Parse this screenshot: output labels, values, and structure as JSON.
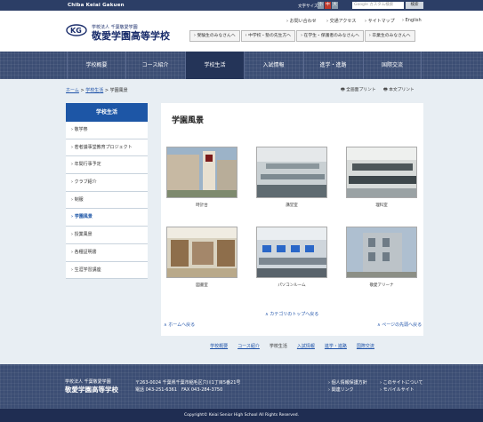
{
  "topbar": {
    "brand": "Chiba Keiai Gakuen",
    "font_size_label": "文字サイズ",
    "font_small": "小",
    "font_medium": "中",
    "font_large": "大",
    "search_placeholder": "Google カスタム検索",
    "search_button": "検索"
  },
  "header": {
    "org_small": "学校法人 千葉敬愛学園",
    "school_name": "敬愛学園高等学校",
    "links": [
      "お問い合わせ",
      "交通アクセス",
      "サイトマップ",
      "English"
    ],
    "audience_tabs": [
      "受験生のみなさんへ",
      "中学校・塾の先生方へ",
      "在学生・保護者のみなさんへ",
      "卒業生のみなさんへ"
    ]
  },
  "nav": [
    "学校概要",
    "コース紹介",
    "学校生活",
    "入試情報",
    "進学・進路",
    "国際交流"
  ],
  "nav_active": "学校生活",
  "breadcrumb": {
    "home": "ホーム",
    "parent": "学校生活",
    "current": "学園風景"
  },
  "print": {
    "full": "全画面プリント",
    "body": "本文プリント"
  },
  "sidebar": {
    "heading": "学校生活",
    "items": [
      "敬学祭",
      "若者議事堂教育プロジェクト",
      "年間行事予定",
      "クラブ紹介",
      "制服",
      "学園風景",
      "授業風景",
      "各種証明書",
      "生涯学習講座"
    ],
    "active": "学園風景"
  },
  "main": {
    "title": "学園風景",
    "photos": [
      {
        "caption": "時計台"
      },
      {
        "caption": "講堂室"
      },
      {
        "caption": "理科室"
      },
      {
        "caption": "図書室"
      },
      {
        "caption": "パソコンルーム"
      },
      {
        "caption": "敬愛アリーナ"
      }
    ],
    "back_to_category": "カテゴリのトップへ戻る",
    "back_to_home": "ホームへ戻る",
    "back_to_top": "ページの先頭へ戻る"
  },
  "bottom_nav": [
    "学校概要",
    "コース紹介",
    "学校生活",
    "入試情報",
    "進学・進路",
    "国際交流"
  ],
  "footer": {
    "org_small": "学校法人 千葉敬愛学園",
    "school_name": "敬愛学園高等学校",
    "address": "〒263-0024 千葉県千葉市稲毛区穴川1丁目5番21号",
    "tel": "電話 043-251-6361　FAX 043-284-3750",
    "links": [
      "個人情報保護方針",
      "このサイトについて",
      "関連リンク",
      "モバイルサイト"
    ],
    "copyright": "Copyright© Keiai Senior High School All Rights Reserved."
  },
  "colors": {
    "topbar": "#2c3e66",
    "nav": "#3c4e74",
    "sidebar_head": "#1d56a6",
    "font_medium_active": "#c0392b"
  }
}
